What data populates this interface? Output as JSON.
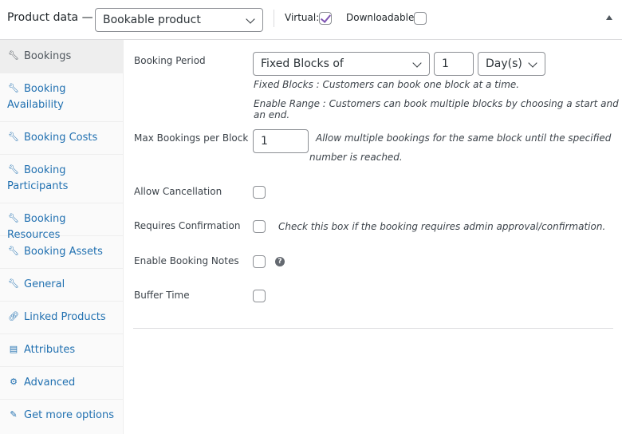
{
  "header": {
    "title": "Product data —",
    "product_type": "Bookable product",
    "virtual_label": "Virtual:",
    "virtual_checked": true,
    "downloadable_label": "Downloadable:",
    "downloadable_checked": false
  },
  "sidebar": {
    "items": [
      {
        "label": "Bookings",
        "icon": "wrench-icon",
        "active": true
      },
      {
        "label": "Booking Availability",
        "icon": "wrench-icon"
      },
      {
        "label": "Booking Costs",
        "icon": "wrench-icon"
      },
      {
        "label": "Booking Participants",
        "icon": "wrench-icon"
      },
      {
        "label": "Booking Resources",
        "icon": "wrench-icon"
      },
      {
        "label": "Booking Assets",
        "icon": "wrench-icon"
      },
      {
        "label": "General",
        "icon": "wrench-icon"
      },
      {
        "label": "Linked Products",
        "icon": "link-icon"
      },
      {
        "label": "Attributes",
        "icon": "table-icon"
      },
      {
        "label": "Advanced",
        "icon": "gear-icon"
      },
      {
        "label": "Get more options",
        "icon": "plugin-icon"
      }
    ]
  },
  "fields": {
    "booking_period": {
      "label": "Booking Period",
      "type_value": "Fixed Blocks of",
      "count_value": "1",
      "unit_value": "Day(s)",
      "desc1": "Fixed Blocks : Customers can book one block at a time.",
      "desc2": "Enable Range : Customers can book multiple blocks by choosing a start and an end."
    },
    "max_bookings": {
      "label": "Max Bookings per Block",
      "value": "1",
      "desc_line1": "Allow multiple bookings for the same block until the specified",
      "desc_line2": "number is reached."
    },
    "allow_cancellation": {
      "label": "Allow Cancellation",
      "checked": false
    },
    "requires_confirmation": {
      "label": "Requires Confirmation",
      "checked": false,
      "desc": "Check this box if the booking requires admin approval/confirmation."
    },
    "enable_booking_notes": {
      "label": "Enable Booking Notes",
      "checked": false,
      "help": "?"
    },
    "buffer_time": {
      "label": "Buffer Time",
      "checked": false
    }
  },
  "colors": {
    "accent": "#2271b1",
    "check": "#7f54b3"
  }
}
